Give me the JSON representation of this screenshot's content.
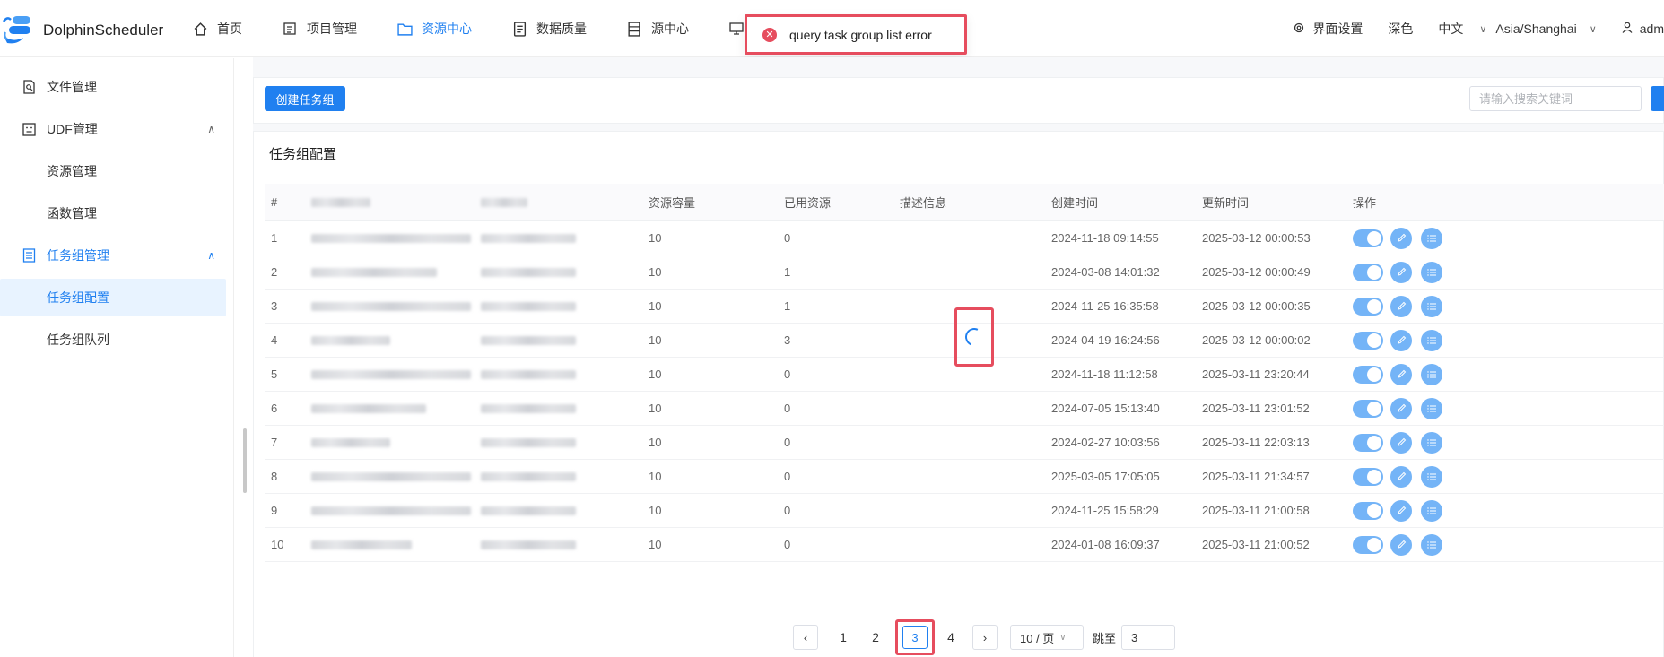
{
  "header": {
    "logo_text": "DolphinScheduler",
    "nav": [
      {
        "label": "首页",
        "icon": "home-icon"
      },
      {
        "label": "项目管理",
        "icon": "project-icon"
      },
      {
        "label": "资源中心",
        "icon": "folder-icon",
        "active": true
      },
      {
        "label": "数据质量",
        "icon": "quality-icon"
      },
      {
        "label": "源中心",
        "icon": "datasource-icon"
      }
    ],
    "ui_settings": "界面设置",
    "theme": "深色",
    "language": "中文",
    "timezone": "Asia/Shanghai",
    "user": "adm"
  },
  "toast": {
    "type": "error",
    "message": "query task group list error"
  },
  "sidebar": {
    "items": [
      {
        "label": "文件管理",
        "icon": "file-search-icon"
      },
      {
        "label": "UDF管理",
        "icon": "udf-icon",
        "expanded": true
      },
      {
        "label": "资源管理"
      },
      {
        "label": "函数管理"
      },
      {
        "label": "任务组管理",
        "icon": "task-group-icon",
        "expanded": true
      },
      {
        "label": "任务组配置",
        "selected": true
      },
      {
        "label": "任务组队列"
      }
    ]
  },
  "toolbar": {
    "create_label": "创建任务组",
    "search_placeholder": "请输入搜索关键词"
  },
  "card": {
    "title": "任务组配置"
  },
  "table": {
    "headers": {
      "idx": "#",
      "capacity": "资源容量",
      "used": "已用资源",
      "description": "描述信息",
      "create_time": "创建时间",
      "update_time": "更新时间",
      "operation": "操作"
    },
    "rows": [
      {
        "idx": "1",
        "capacity": "10",
        "used": "0",
        "create_time": "2024-11-18 09:14:55",
        "update_time": "2025-03-12 00:00:53"
      },
      {
        "idx": "2",
        "capacity": "10",
        "used": "1",
        "create_time": "2024-03-08 14:01:32",
        "update_time": "2025-03-12 00:00:49"
      },
      {
        "idx": "3",
        "capacity": "10",
        "used": "1",
        "create_time": "2024-11-25 16:35:58",
        "update_time": "2025-03-12 00:00:35"
      },
      {
        "idx": "4",
        "capacity": "10",
        "used": "3",
        "create_time": "2024-04-19 16:24:56",
        "update_time": "2025-03-12 00:00:02"
      },
      {
        "idx": "5",
        "capacity": "10",
        "used": "0",
        "create_time": "2024-11-18 11:12:58",
        "update_time": "2025-03-11 23:20:44"
      },
      {
        "idx": "6",
        "capacity": "10",
        "used": "0",
        "create_time": "2024-07-05 15:13:40",
        "update_time": "2025-03-11 23:01:52"
      },
      {
        "idx": "7",
        "capacity": "10",
        "used": "0",
        "create_time": "2024-02-27 10:03:56",
        "update_time": "2025-03-11 22:03:13"
      },
      {
        "idx": "8",
        "capacity": "10",
        "used": "0",
        "create_time": "2025-03-05 17:05:05",
        "update_time": "2025-03-11 21:34:57"
      },
      {
        "idx": "9",
        "capacity": "10",
        "used": "0",
        "create_time": "2024-11-25 15:58:29",
        "update_time": "2025-03-11 21:00:58"
      },
      {
        "idx": "10",
        "capacity": "10",
        "used": "0",
        "create_time": "2024-01-08 16:09:37",
        "update_time": "2025-03-11 21:00:52"
      }
    ]
  },
  "pagination": {
    "pages": [
      "1",
      "2",
      "3",
      "4"
    ],
    "current": "3",
    "page_size": "10 / 页",
    "jump_label": "跳至",
    "jump_value": "3"
  },
  "colors": {
    "accent": "#2080f0",
    "error": "#e64d5e",
    "toggle": "#74b4f7"
  }
}
